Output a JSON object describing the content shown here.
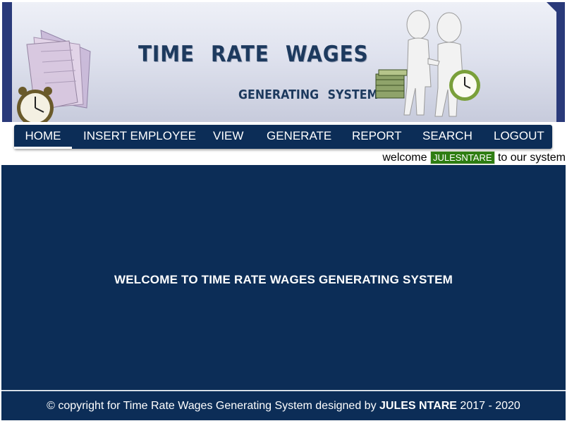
{
  "header": {
    "title": "TIME   RATE   WAGES",
    "subtitle": "GENERATING   SYSTEM"
  },
  "nav": {
    "items": [
      {
        "label": "HOME",
        "active": true
      },
      {
        "label": "INSERT EMPLOYEE"
      },
      {
        "label": "VIEW"
      },
      {
        "label": "GENERATE"
      },
      {
        "label": "REPORT"
      },
      {
        "label": "SEARCH"
      },
      {
        "label": "LOGOUT"
      }
    ]
  },
  "welcome": {
    "prefix": "welcome",
    "username": "JULESNTARE",
    "suffix": "to our system"
  },
  "main": {
    "heading": "WELCOME TO TIME RATE WAGES GENERATING SYSTEM"
  },
  "footer": {
    "prefix": "© copyright for Time Rate Wages Generating System designed by",
    "author": "JULES NTARE",
    "years": "2017 - 2020"
  },
  "colors": {
    "navy": "#0c2d57",
    "banner_frame": "#2a3a7a",
    "user_badge": "#2e7d12"
  }
}
